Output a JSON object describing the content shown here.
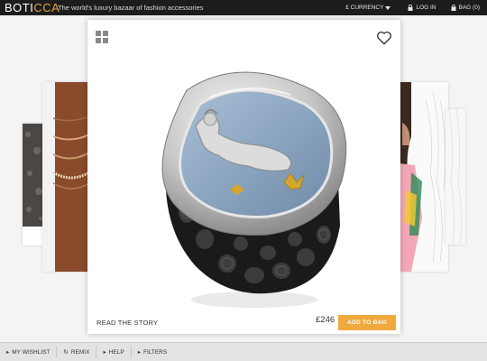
{
  "header": {
    "logo_part1": "BOTI",
    "logo_part2": "CCA",
    "tagline": "The world's luxury bazaar of fashion accessories",
    "currency_label": "£ CURRENCY",
    "login_label": "LOG IN",
    "bag_label": "BAG (0)"
  },
  "product": {
    "story_label": "READ THE STORY",
    "price": "£246",
    "add_to_bag_label": "ADD TO BAG"
  },
  "footer": {
    "wishlist_label": "MY WISHLIST",
    "remix_label": "REMIX",
    "help_label": "HELP",
    "filters_label": "FILTERS"
  },
  "colors": {
    "topbar": "#1c1c1c",
    "accent": "#f0a93e",
    "logo_accent": "#e8a13a"
  }
}
